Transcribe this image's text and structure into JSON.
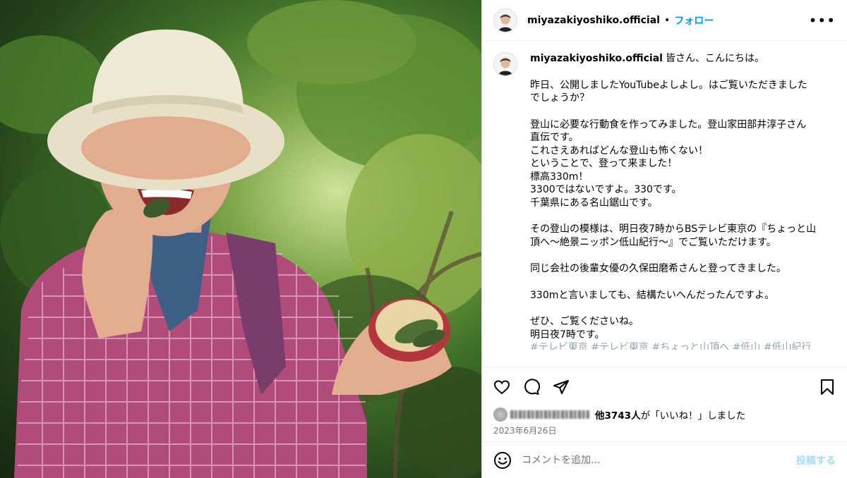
{
  "post": {
    "username": "miyazakiyoshiko.official",
    "separator": "•",
    "follow_label": "フォロー",
    "more_label": "•••"
  },
  "caption": {
    "first_line": "皆さん、こんにちは。",
    "lines": [
      "",
      "昨日、公開しましたYouTubeよしよし。はご覧いただきました",
      "でしょうか？",
      "",
      "登山に必要な行動食を作ってみました。登山家田部井淳子さん",
      "直伝です。",
      "これさえあればどんな登山も怖くない！",
      "ということで、登って来ました！",
      "標高330m！",
      "3300ではないですよ。330です。",
      "千葉県にある名山鋸山です。",
      "",
      "その登山の模様は、明日夜7時からBSテレビ東京の『ちょっと山",
      "頂へ～絶景ニッポン低山紀行～』でご覧いただけます。",
      "",
      "同じ会社の後輩女優の久保田磨希さんと登ってきました。",
      "",
      "330mと言いましても、結構たいへんだったんですよ。",
      "",
      "ぜひ、ご覧くださいね。",
      "明日夜7時です。"
    ],
    "hashtags_cut": "#テレビ東京 #テレビ東京 #ちょっと山頂へ #低山 #低山紀行"
  },
  "actions": {
    "icons": [
      "heart-icon",
      "comment-icon",
      "share-icon",
      "bookmark-icon"
    ]
  },
  "likes": {
    "count_text": "他3743人",
    "suffix_text": "が「いいね！」しました"
  },
  "date": "2023年6月26日",
  "comment_box": {
    "placeholder": "コメントを追加...",
    "post_label": "投稿する"
  },
  "colors": {
    "accent": "#0095f6",
    "border": "#dbdbdb",
    "muted": "#737373"
  }
}
